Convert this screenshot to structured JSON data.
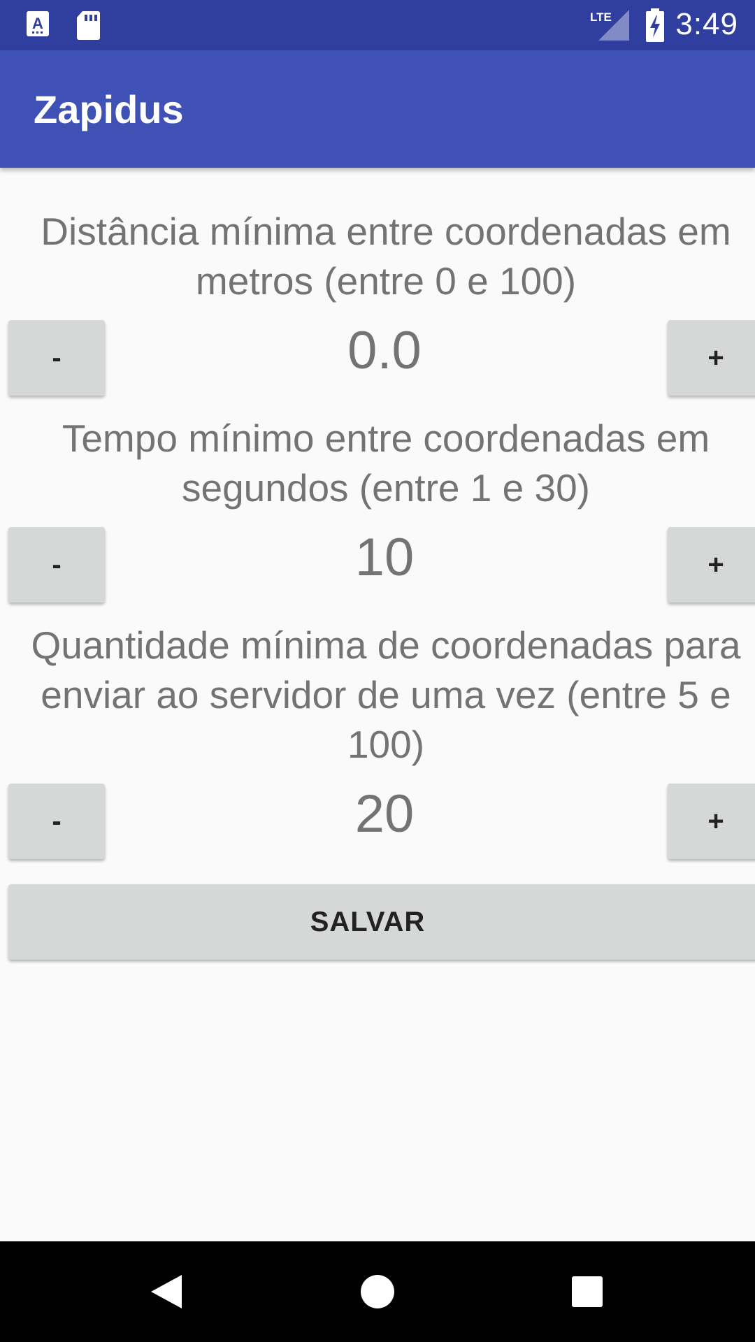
{
  "status_bar": {
    "time": "3:49",
    "icons": [
      "accessibility-app-icon",
      "sd-card-icon",
      "lte-signal-icon",
      "battery-charging-icon"
    ],
    "lte_label": "LTE"
  },
  "app_bar": {
    "title": "Zapidus"
  },
  "settings": [
    {
      "label": "Distância mínima entre coordenadas em metros (entre 0 e 100)",
      "value": "0.0",
      "minus_label": "-",
      "plus_label": "+"
    },
    {
      "label": "Tempo mínimo entre coordenadas em segundos (entre 1 e 30)",
      "value": "10",
      "minus_label": "-",
      "plus_label": "+"
    },
    {
      "label": "Quantidade mínima de coordenadas para enviar ao servidor de uma vez (entre 5 e 100)",
      "value": "20",
      "minus_label": "-",
      "plus_label": "+"
    }
  ],
  "save_button": {
    "label": "SALVAR"
  },
  "nav_bar": {
    "buttons": [
      "back-icon",
      "home-icon",
      "recents-icon"
    ]
  },
  "colors": {
    "status_bar": "#303f9f",
    "app_bar": "#3f51b5",
    "background": "#fafafa",
    "button": "#d6d7d7",
    "text_secondary": "#737373"
  }
}
